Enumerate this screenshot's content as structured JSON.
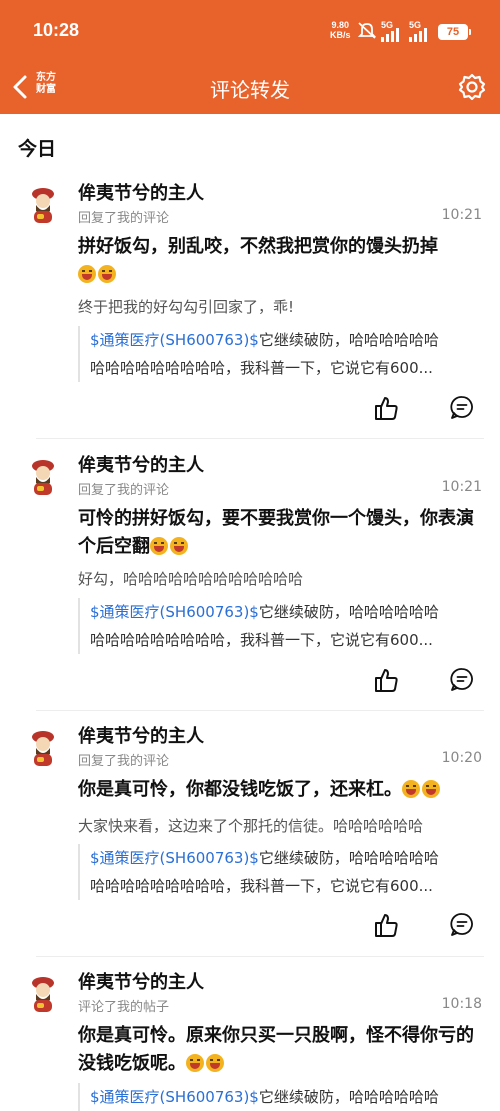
{
  "status_bar": {
    "time": "10:28",
    "net_speed": "9.80",
    "net_unit": "KB/s",
    "battery": "75",
    "signal_labels": [
      "5G",
      "5G"
    ]
  },
  "header": {
    "brand": "东方财富",
    "title": "评论转发"
  },
  "section_title": "今日",
  "items": [
    {
      "user": "侔夷节兮的主人",
      "action": "回复了我的评论",
      "time": "10:21",
      "reply": "拼好饭勾，别乱咬，不然我把赏你的馒头扔掉",
      "emoji_count": 2,
      "original": "终于把我的好勾勾引回家了，乖!",
      "quote_stock": "$通策医疗(SH600763)$",
      "quote_line1": "它继续破防，哈哈哈哈哈哈",
      "quote_line2": "哈哈哈哈哈哈哈哈哈，我科普一下，它说它有600..."
    },
    {
      "user": "侔夷节兮的主人",
      "action": "回复了我的评论",
      "time": "10:21",
      "reply": "可怜的拼好饭勾，要不要我赏你一个馒头，你表演个后空翻",
      "emoji_count": 2,
      "original": "好勾，哈哈哈哈哈哈哈哈哈哈哈哈",
      "quote_stock": "$通策医疗(SH600763)$",
      "quote_line1": "它继续破防，哈哈哈哈哈哈",
      "quote_line2": "哈哈哈哈哈哈哈哈哈，我科普一下，它说它有600..."
    },
    {
      "user": "侔夷节兮的主人",
      "action": "回复了我的评论",
      "time": "10:20",
      "reply": "你是真可怜，你都没钱吃饭了，还来杠。",
      "emoji_count": 2,
      "original": "大家快来看，这边来了个那托的信徒。哈哈哈哈哈哈",
      "quote_stock": "$通策医疗(SH600763)$",
      "quote_line1": "它继续破防，哈哈哈哈哈哈",
      "quote_line2": "哈哈哈哈哈哈哈哈哈，我科普一下，它说它有600..."
    },
    {
      "user": "侔夷节兮的主人",
      "action": "评论了我的帖子",
      "time": "10:18",
      "reply": "你是真可怜。原来你只买一只股啊，怪不得你亏的没钱吃饭呢。",
      "emoji_count": 2,
      "quote_stock": "$通策医疗(SH600763)$",
      "quote_line1": "它继续破防，哈哈哈哈哈哈"
    }
  ],
  "colors": {
    "brand_orange": "#e8622c",
    "stock_link": "#2a6fd6"
  },
  "icons": [
    "back-chevron-icon",
    "settings-gear-icon",
    "thumbs-up-icon",
    "comment-bubble-icon",
    "laughing-emoji-icon"
  ]
}
